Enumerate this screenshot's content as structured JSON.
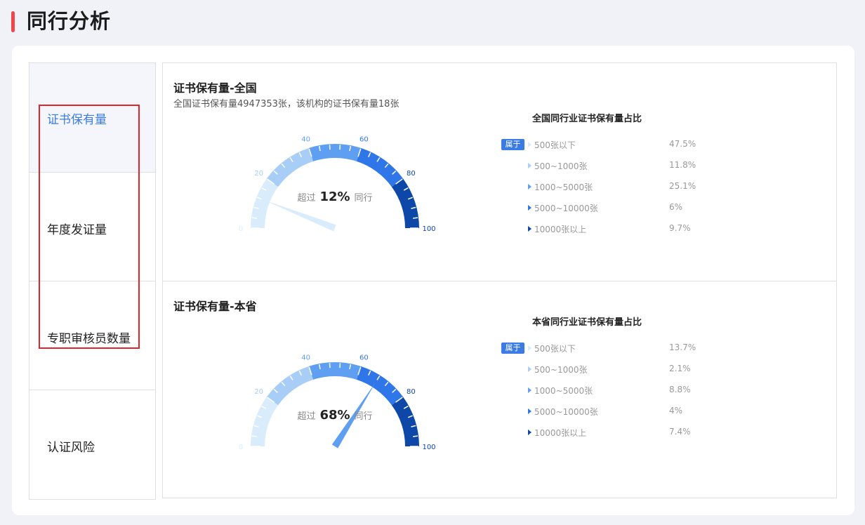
{
  "page": {
    "title": "同行分析"
  },
  "tabs": [
    {
      "label": "证书保有量",
      "active": true
    },
    {
      "label": "年度发证量",
      "active": false
    },
    {
      "label": "专职审核员数量",
      "active": false
    },
    {
      "label": "认证风险",
      "active": false
    }
  ],
  "panels": [
    {
      "title": "证书保有量-全国",
      "subtitle": "全国证书保有量4947353张，该机构的证书保有量18张",
      "gauge": {
        "value": 12,
        "prefix": "超过",
        "value_label": "12%",
        "suffix": "同行",
        "scale_labels": [
          "0",
          "20",
          "40",
          "60",
          "80",
          "100"
        ],
        "band_colors": [
          "#d9ecfb",
          "#a8cef7",
          "#5f9ff2",
          "#2f76e8",
          "#0d47a8"
        ]
      },
      "distribution": {
        "title": "全国同行业证书保有量占比",
        "badge": "属于",
        "rows": [
          {
            "label": "500张以下",
            "value": "47.5%",
            "marker_color": "#d9ecfb"
          },
          {
            "label": "500~1000张",
            "value": "11.8%",
            "marker_color": "#a8cef7"
          },
          {
            "label": "1000~5000张",
            "value": "25.1%",
            "marker_color": "#5f9ff2"
          },
          {
            "label": "5000~10000张",
            "value": "6%",
            "marker_color": "#2f76e8"
          },
          {
            "label": "10000张以上",
            "value": "9.7%",
            "marker_color": "#0d47a8"
          }
        ]
      }
    },
    {
      "title": "证书保有量-本省",
      "subtitle": "",
      "gauge": {
        "value": 68,
        "prefix": "超过",
        "value_label": "68%",
        "suffix": "同行",
        "scale_labels": [
          "0",
          "20",
          "40",
          "60",
          "80",
          "100"
        ],
        "band_colors": [
          "#d9ecfb",
          "#a8cef7",
          "#5f9ff2",
          "#2f76e8",
          "#0d47a8"
        ]
      },
      "distribution": {
        "title": "本省同行业证书保有量占比",
        "badge": "属于",
        "rows": [
          {
            "label": "500张以下",
            "value": "13.7%",
            "marker_color": "#d9ecfb"
          },
          {
            "label": "500~1000张",
            "value": "2.1%",
            "marker_color": "#a8cef7"
          },
          {
            "label": "1000~5000张",
            "value": "8.8%",
            "marker_color": "#5f9ff2"
          },
          {
            "label": "5000~10000张",
            "value": "4%",
            "marker_color": "#2f76e8"
          },
          {
            "label": "10000张以上",
            "value": "7.4%",
            "marker_color": "#0d47a8"
          }
        ]
      }
    }
  ]
}
